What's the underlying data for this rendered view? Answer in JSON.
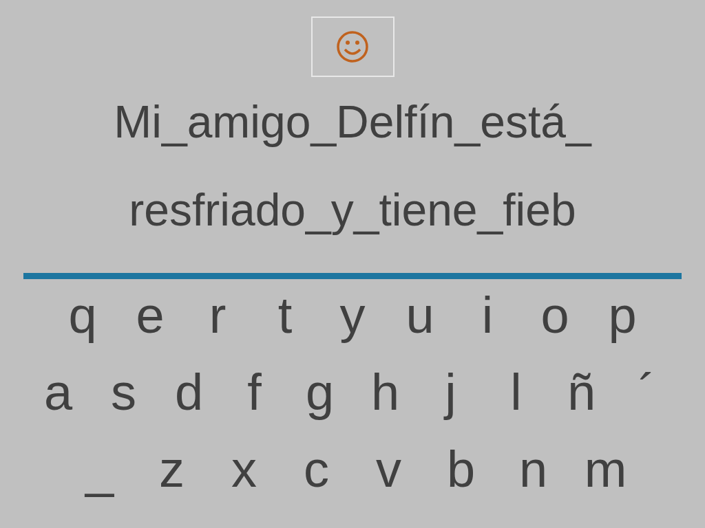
{
  "sentence": {
    "lines": [
      "Mi_amigo_Delfín_está_",
      "resfriado_y_tiene_fieb"
    ]
  },
  "keyboard": {
    "rows": [
      [
        "q",
        "e",
        "r",
        "t",
        "y",
        "u",
        "i",
        "o",
        "p"
      ],
      [
        "a",
        "s",
        "d",
        "f",
        "g",
        "h",
        "j",
        "l",
        "ñ",
        "´"
      ],
      [
        "_",
        "z",
        "x",
        "c",
        "v",
        "b",
        "n",
        "m"
      ]
    ]
  }
}
